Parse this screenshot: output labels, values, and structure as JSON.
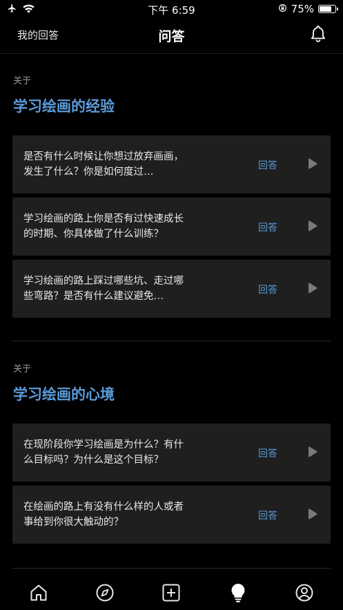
{
  "status": {
    "time": "下午 6:59",
    "battery_text": "75%",
    "battery_level": 0.75
  },
  "nav": {
    "left_label": "我的回答",
    "title": "问答"
  },
  "sections": [
    {
      "about": "关于",
      "title": "学习绘画的经验",
      "questions": [
        {
          "text": "是否有什么时候让你想过放弃画画，发生了什么？你是如何度过…",
          "answer_label": "回答"
        },
        {
          "text": "学习绘画的路上你是否有过快速成长的时期、你具体做了什么训练？",
          "answer_label": "回答"
        },
        {
          "text": "学习绘画的路上踩过哪些坑、走过哪些弯路？是否有什么建议避免…",
          "answer_label": "回答"
        }
      ]
    },
    {
      "about": "关于",
      "title": "学习绘画的心境",
      "questions": [
        {
          "text": "在现阶段你学习绘画是为什么？有什么目标吗？为什么是这个目标？",
          "answer_label": "回答"
        },
        {
          "text": "在绘画的路上有没有什么样的人或者事给到你很大触动的？",
          "answer_label": "回答"
        }
      ]
    }
  ],
  "tabs": [
    {
      "name": "home-icon",
      "active": false
    },
    {
      "name": "compass-icon",
      "active": false
    },
    {
      "name": "add-icon",
      "active": false
    },
    {
      "name": "lightbulb-icon",
      "active": true
    },
    {
      "name": "profile-icon",
      "active": false
    }
  ],
  "colors": {
    "background": "#000000",
    "card": "#1f1f1f",
    "accent": "#5b9bd9",
    "text": "#e8e8e8",
    "muted": "#9a9a9a"
  }
}
